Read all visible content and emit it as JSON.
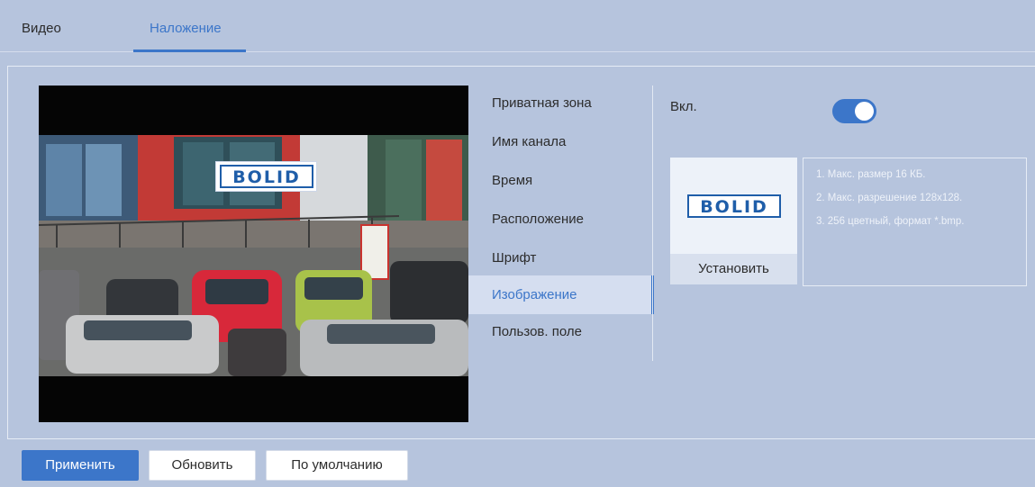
{
  "tabs": [
    {
      "label": "Видео",
      "active": false
    },
    {
      "label": "Наложение",
      "active": true
    }
  ],
  "menu": {
    "items": [
      {
        "label": "Приватная зона"
      },
      {
        "label": "Имя канала"
      },
      {
        "label": "Время"
      },
      {
        "label": "Расположение"
      },
      {
        "label": "Шрифт"
      },
      {
        "label": "Изображение",
        "active": true
      },
      {
        "label": "Пользов. поле"
      }
    ]
  },
  "settings": {
    "enable_label": "Вкл.",
    "enabled": true,
    "logo_text": "BOLID",
    "install_label": "Установить",
    "hints": [
      "1. Макс. размер 16 КБ.",
      "2. Макс. разрешение 128x128.",
      "3. 256 цветный, формат *.bmp."
    ]
  },
  "buttons": {
    "apply": "Применить",
    "refresh": "Обновить",
    "default": "По умолчанию"
  },
  "colors": {
    "accent": "#3c76c9",
    "background": "#b6c4dd",
    "logo_blue": "#1f5ea9"
  }
}
